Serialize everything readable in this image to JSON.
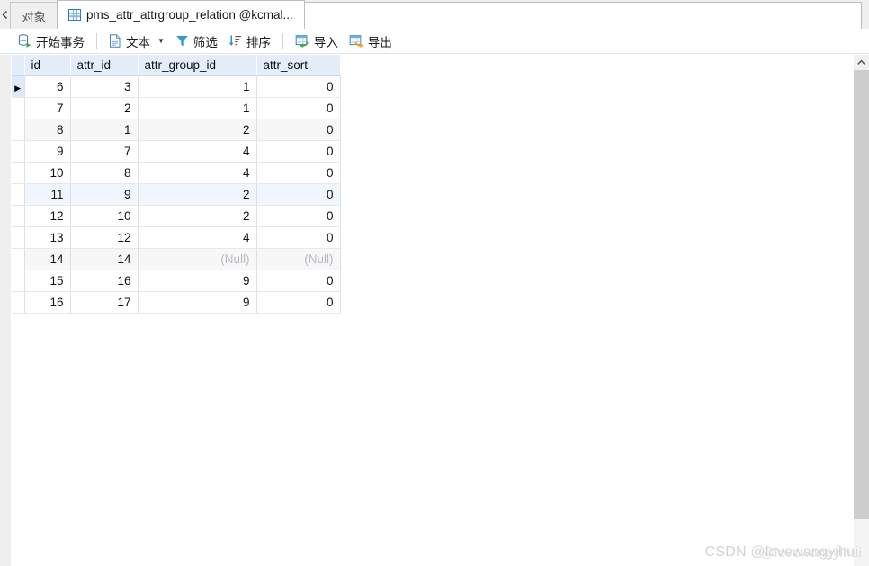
{
  "tabbar": {
    "scroll_left_icon": "chevron-left-icon",
    "tabs": [
      {
        "label": "对象",
        "active": false,
        "icon": null
      },
      {
        "label": "pms_attr_attrgroup_relation @kcmal...",
        "active": true,
        "icon": "table-grid-icon"
      }
    ]
  },
  "toolbar": {
    "items": [
      {
        "label": "开始事务",
        "icon": "begin-transaction-icon",
        "caret": false
      },
      {
        "label": "文本",
        "icon": "text-document-icon",
        "caret": true
      },
      {
        "label": "筛选",
        "icon": "filter-funnel-icon",
        "caret": false
      },
      {
        "label": "排序",
        "icon": "sort-descending-icon",
        "caret": false
      },
      {
        "label": "导入",
        "icon": "import-icon",
        "caret": false
      },
      {
        "label": "导出",
        "icon": "export-icon",
        "caret": false
      }
    ]
  },
  "grid": {
    "columns": [
      "id",
      "attr_id",
      "attr_group_id",
      "attr_sort"
    ],
    "null_text": "(Null)",
    "current_row_marker": "▶",
    "rows": [
      {
        "id": "6",
        "attr_id": "3",
        "attr_group_id": "1",
        "attr_sort": "0",
        "style": "current"
      },
      {
        "id": "7",
        "attr_id": "2",
        "attr_group_id": "1",
        "attr_sort": "0",
        "style": ""
      },
      {
        "id": "8",
        "attr_id": "1",
        "attr_group_id": "2",
        "attr_sort": "0",
        "style": "stripe"
      },
      {
        "id": "9",
        "attr_id": "7",
        "attr_group_id": "4",
        "attr_sort": "0",
        "style": ""
      },
      {
        "id": "10",
        "attr_id": "8",
        "attr_group_id": "4",
        "attr_sort": "0",
        "style": ""
      },
      {
        "id": "11",
        "attr_id": "9",
        "attr_group_id": "2",
        "attr_sort": "0",
        "style": "hl"
      },
      {
        "id": "12",
        "attr_id": "10",
        "attr_group_id": "2",
        "attr_sort": "0",
        "style": ""
      },
      {
        "id": "13",
        "attr_id": "12",
        "attr_group_id": "4",
        "attr_sort": "0",
        "style": ""
      },
      {
        "id": "14",
        "attr_id": "14",
        "attr_group_id": "(Null)",
        "attr_sort": "(Null)",
        "style": "stripe"
      },
      {
        "id": "15",
        "attr_id": "16",
        "attr_group_id": "9",
        "attr_sort": "0",
        "style": ""
      },
      {
        "id": "16",
        "attr_id": "17",
        "attr_group_id": "9",
        "attr_sort": "0",
        "style": ""
      }
    ]
  },
  "scrollbar": {
    "up_arrow_icon": "chevron-up-icon"
  },
  "watermark": {
    "text": "CSDN @lovewangyihui",
    "ghost": "@lovewangyihui"
  },
  "colors": {
    "header_bg": "#e3eefa",
    "stripe_bg": "#f7f7f7",
    "highlight_bg": "#f0f6fd",
    "null_text": "#b6bcc4",
    "accent_blue": "#2b7cc4",
    "import_arrow": "#4caf50",
    "export_arrow": "#f5a623"
  }
}
